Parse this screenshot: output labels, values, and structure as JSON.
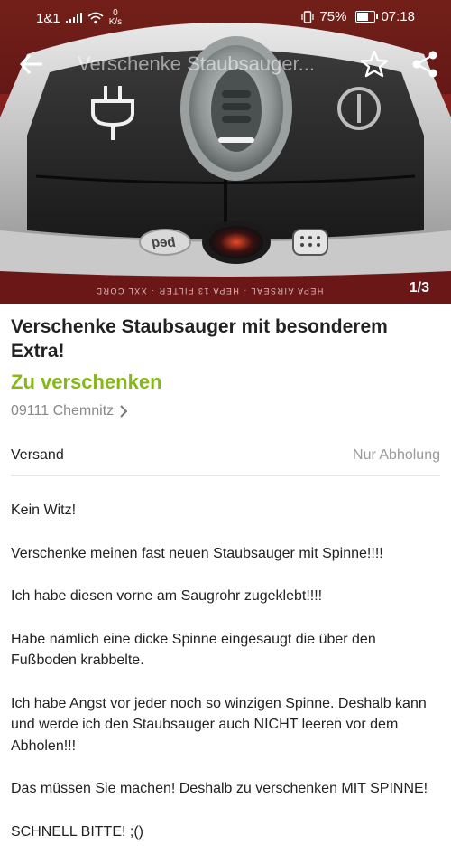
{
  "status_bar": {
    "carrier": "1&1",
    "speed_value": "0",
    "speed_unit": "K/s",
    "battery": "75%",
    "time": "07:18",
    "battery_level": 0.75
  },
  "app_bar": {
    "title": "Verschenke Staubsauger..."
  },
  "gallery": {
    "counter": "1/3",
    "device_text": "HEPA AIRSEAL · HEPA 13 FILTER · XXL CORD",
    "brand": "beq"
  },
  "ad": {
    "title": "Verschenke Staubsauger mit besonderem Extra!",
    "price": "Zu verschenken",
    "location": "09111 Chemnitz"
  },
  "shipping": {
    "label": "Versand",
    "value": "Nur Abholung"
  },
  "description": [
    "Kein Witz!",
    "Verschenke meinen fast neuen Staubsauger mit Spinne!!!!",
    "Ich habe diesen vorne am Saugrohr zugeklebt!!!!",
    "Habe nämlich eine dicke Spinne eingesaugt die über den Fußboden krabbelte.",
    "Ich habe Angst vor jeder noch so winzigen Spinne. Deshalb kann und werde ich den Staubsauger auch NICHT leeren vor dem Abholen!!!",
    "Das müssen Sie machen! Deshalb zu verschenken MIT SPINNE!",
    "SCHNELL BITTE! ;()"
  ],
  "colors": {
    "price_green": "#86b817",
    "hero_red": "#8a1f1f"
  }
}
